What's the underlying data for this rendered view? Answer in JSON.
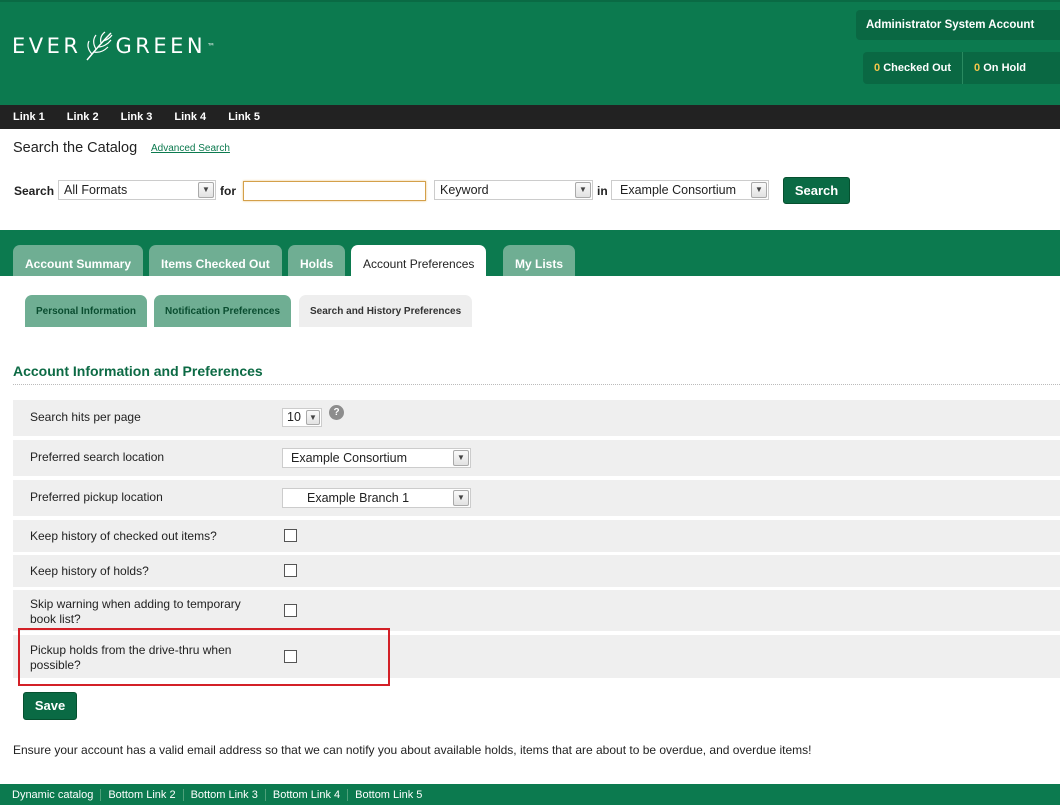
{
  "colors": {
    "brand_green": "#0c7a4f",
    "tab_inactive": "#6fae93",
    "count_yellow": "#f5c64a",
    "highlight_red": "#d32027"
  },
  "header": {
    "logo_left": "EVER",
    "logo_right": "GREEN",
    "logo_tm": "™",
    "account_name": "Administrator System Account",
    "checked_out_count": "0",
    "checked_out_label": "Checked Out",
    "on_hold_count": "0",
    "on_hold_label": "On Hold"
  },
  "top_links": [
    "Link 1",
    "Link 2",
    "Link 3",
    "Link 4",
    "Link 5"
  ],
  "search": {
    "title": "Search the Catalog",
    "advanced_link": "Advanced Search",
    "search_label": "Search",
    "format_value": "All Formats",
    "for_label": "for",
    "query_value": "",
    "type_value": "Keyword",
    "in_label": "in",
    "location_value": "Example Consortium",
    "button_label": "Search"
  },
  "tabs": [
    "Account Summary",
    "Items Checked Out",
    "Holds",
    "Account Preferences",
    "My Lists"
  ],
  "subtabs": [
    "Personal Information",
    "Notification Preferences",
    "Search and History Preferences"
  ],
  "prefs": {
    "heading": "Account Information and Preferences",
    "hits_label": "Search hits per page",
    "hits_value": "10",
    "help_glyph": "?",
    "search_loc_label": "Preferred search location",
    "search_loc_value": "Example Consortium",
    "pickup_label": "Preferred pickup location",
    "pickup_value": "Example Branch 1",
    "keep_checkout_label": "Keep history of checked out items?",
    "keep_holds_label": "Keep history of holds?",
    "skip_warning_label": "Skip warning when adding to temporary book list?",
    "drive_thru_label": "Pickup holds from the drive-thru when possible?",
    "save_label": "Save",
    "notice": "Ensure your account has a valid email address so that we can notify you about available holds, items that are about to be overdue, and overdue items!"
  },
  "footer_links": [
    "Dynamic catalog",
    "Bottom Link 2",
    "Bottom Link 3",
    "Bottom Link 4",
    "Bottom Link 5"
  ]
}
